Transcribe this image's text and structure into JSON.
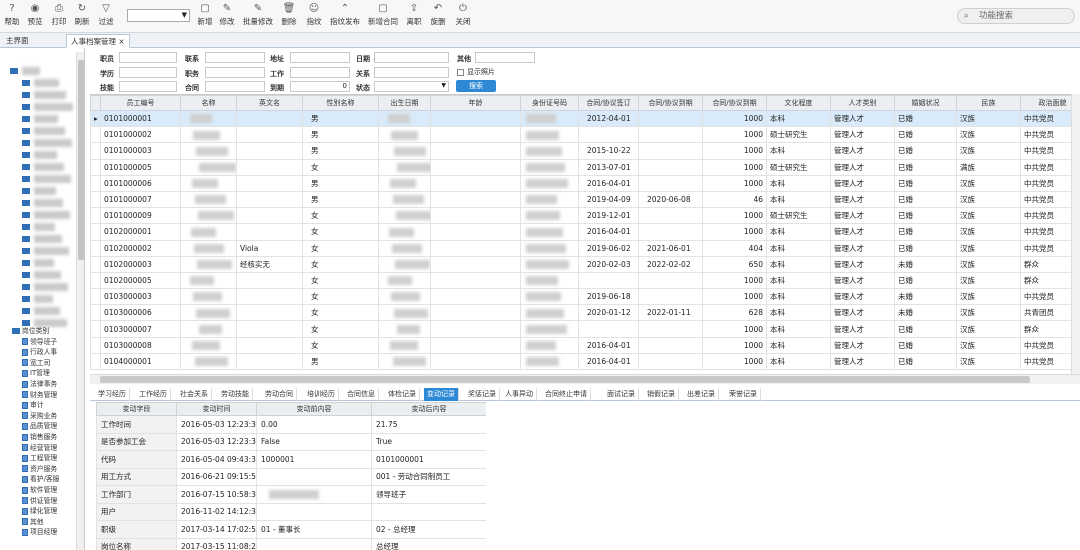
{
  "toolbar": {
    "buttons": [
      {
        "label": "帮助",
        "icon": "help-icon",
        "glyph": "?"
      },
      {
        "label": "预览",
        "icon": "eye-icon",
        "glyph": "◉"
      },
      {
        "label": "打印",
        "icon": "printer-icon",
        "glyph": "⎙"
      },
      {
        "label": "刷新",
        "icon": "refresh-icon",
        "glyph": "↻"
      },
      {
        "label": "过滤",
        "icon": "filter-icon",
        "glyph": "▽"
      },
      {
        "label": "新增",
        "icon": "new-icon",
        "glyph": "▢"
      },
      {
        "label": "修改",
        "icon": "edit-icon",
        "glyph": "✎"
      },
      {
        "label": "批量修改",
        "icon": "batch-edit-icon",
        "glyph": "✎"
      },
      {
        "label": "删除",
        "icon": "delete-icon",
        "glyph": "🗑"
      },
      {
        "label": "指纹",
        "icon": "user-icon",
        "glyph": "☺"
      },
      {
        "label": "指纹发布",
        "icon": "publish-icon",
        "glyph": "⌃"
      },
      {
        "label": "新增合同",
        "icon": "new-contract-icon",
        "glyph": "▢"
      },
      {
        "label": "离职",
        "icon": "export-icon",
        "glyph": "⇪"
      },
      {
        "label": "旋删",
        "icon": "undo-icon",
        "glyph": "↶"
      },
      {
        "label": "关闭",
        "icon": "power-icon",
        "glyph": "⏻"
      }
    ],
    "search_placeholder": "功能搜索"
  },
  "tabs": [
    {
      "label": "主界面"
    },
    {
      "label": "人事档案管理"
    }
  ],
  "tree": {
    "bottom_items": [
      "岗位类别",
      "领导班子",
      "行政人事",
      "宽工司",
      "IT管理",
      "法律事务",
      "财务管理",
      "审计",
      "采购业务",
      "品质管理",
      "销售服务",
      "经营管理",
      "工程管理",
      "资户服务",
      "看护/客服",
      "软件管理",
      "供证管理",
      "绿化管理",
      "其他",
      "项目经理"
    ]
  },
  "filters": {
    "labels": [
      "职员",
      "联系",
      "地址",
      "日期",
      "其他",
      "学历",
      "职务",
      "工作",
      "关系",
      "技能",
      "合同",
      "到期",
      "状态"
    ],
    "show_photo": "显示照片",
    "date_value": "0",
    "search_button": "搜索"
  },
  "grid": {
    "columns": [
      "员工编号",
      "名称",
      "英文名",
      "性别名称",
      "出生日期",
      "年龄",
      "身份证号码",
      "合同/协议签订",
      "合同/协议到期",
      "合同/协议到期",
      "文化程度",
      "人才类别",
      "婚姻状况",
      "民族",
      "政治面貌"
    ],
    "rows": [
      {
        "id": "0101000001",
        "en": "",
        "sex": "男",
        "sign": "2012-04-01",
        "end": "",
        "days": "1000",
        "edu": "本科",
        "talent": "管理人才",
        "marital": "已婚",
        "ethnic": "汉族",
        "political": "中共党员"
      },
      {
        "id": "0101000002",
        "en": "",
        "sex": "男",
        "sign": "",
        "end": "",
        "days": "1000",
        "edu": "硕士研究生",
        "talent": "管理人才",
        "marital": "已婚",
        "ethnic": "汉族",
        "political": "中共党员"
      },
      {
        "id": "0101000003",
        "en": "",
        "sex": "男",
        "sign": "2015-10-22",
        "end": "",
        "days": "1000",
        "edu": "本科",
        "talent": "管理人才",
        "marital": "已婚",
        "ethnic": "汉族",
        "political": "中共党员"
      },
      {
        "id": "0101000005",
        "en": "",
        "sex": "女",
        "sign": "2013-07-01",
        "end": "",
        "days": "1000",
        "edu": "硕士研究生",
        "talent": "管理人才",
        "marital": "已婚",
        "ethnic": "满族",
        "political": "中共党员"
      },
      {
        "id": "0101000006",
        "en": "",
        "sex": "男",
        "sign": "2016-04-01",
        "end": "",
        "days": "1000",
        "edu": "本科",
        "talent": "管理人才",
        "marital": "已婚",
        "ethnic": "汉族",
        "political": "中共党员"
      },
      {
        "id": "0101000007",
        "en": "",
        "sex": "男",
        "sign": "2019-04-09",
        "end": "2020-06-08",
        "days": "46",
        "edu": "本科",
        "talent": "管理人才",
        "marital": "已婚",
        "ethnic": "汉族",
        "political": "中共党员"
      },
      {
        "id": "0101000009",
        "en": "",
        "sex": "女",
        "sign": "2019-12-01",
        "end": "",
        "days": "1000",
        "edu": "硕士研究生",
        "talent": "管理人才",
        "marital": "已婚",
        "ethnic": "汉族",
        "political": "中共党员"
      },
      {
        "id": "0102000001",
        "en": "",
        "sex": "女",
        "sign": "2016-04-01",
        "end": "",
        "days": "1000",
        "edu": "本科",
        "talent": "管理人才",
        "marital": "已婚",
        "ethnic": "汉族",
        "political": "中共党员"
      },
      {
        "id": "0102000002",
        "en": "Viola",
        "sex": "女",
        "sign": "2019-06-02",
        "end": "2021-06-01",
        "days": "404",
        "edu": "本科",
        "talent": "管理人才",
        "marital": "已婚",
        "ethnic": "汉族",
        "political": "中共党员"
      },
      {
        "id": "0102000003",
        "en": "经核实无",
        "sex": "女",
        "sign": "2020-02-03",
        "end": "2022-02-02",
        "days": "650",
        "edu": "本科",
        "talent": "管理人才",
        "marital": "未婚",
        "ethnic": "汉族",
        "political": "群众"
      },
      {
        "id": "0102000005",
        "en": "",
        "sex": "女",
        "sign": "",
        "end": "",
        "days": "1000",
        "edu": "本科",
        "talent": "管理人才",
        "marital": "已婚",
        "ethnic": "汉族",
        "political": "群众"
      },
      {
        "id": "0103000003",
        "en": "",
        "sex": "女",
        "sign": "2019-06-18",
        "end": "",
        "days": "1000",
        "edu": "本科",
        "talent": "管理人才",
        "marital": "未婚",
        "ethnic": "汉族",
        "political": "中共党员"
      },
      {
        "id": "0103000006",
        "en": "",
        "sex": "女",
        "sign": "2020-01-12",
        "end": "2022-01-11",
        "days": "628",
        "edu": "本科",
        "talent": "管理人才",
        "marital": "未婚",
        "ethnic": "汉族",
        "political": "共青团员"
      },
      {
        "id": "0103000007",
        "en": "",
        "sex": "女",
        "sign": "",
        "end": "",
        "days": "1000",
        "edu": "本科",
        "talent": "管理人才",
        "marital": "已婚",
        "ethnic": "汉族",
        "political": "群众"
      },
      {
        "id": "0103000008",
        "en": "",
        "sex": "女",
        "sign": "2016-04-01",
        "end": "",
        "days": "1000",
        "edu": "本科",
        "talent": "管理人才",
        "marital": "已婚",
        "ethnic": "汉族",
        "political": "中共党员"
      },
      {
        "id": "0104000001",
        "en": "",
        "sex": "男",
        "sign": "2016-04-01",
        "end": "",
        "days": "1000",
        "edu": "本科",
        "talent": "管理人才",
        "marital": "已婚",
        "ethnic": "汉族",
        "political": "中共党员"
      }
    ]
  },
  "subtabs": [
    "学习经历",
    "工作经历",
    "社会关系",
    "劳动技能",
    "劳动合同",
    "培训经历",
    "合同信息",
    "体检记录",
    "变动记录",
    "奖惩记录",
    "人事异动",
    "合同终止申请",
    "面试记录",
    "销假记录",
    "出差记录",
    "荣誉记录"
  ],
  "detail": {
    "columns": [
      "变动字段",
      "变动时间",
      "变动前内容",
      "变动后内容"
    ],
    "rows": [
      {
        "field": "工作时间",
        "time": "2016-05-03 12:23:3",
        "before": "0.00",
        "after": "21.75"
      },
      {
        "field": "是否参加工会",
        "time": "2016-05-03 12:23:3",
        "before": "False",
        "after": "True"
      },
      {
        "field": "代码",
        "time": "2016-05-04 09:43:3",
        "before": "1000001",
        "after": "0101000001"
      },
      {
        "field": "用工方式",
        "time": "2016-06-21 09:15:5",
        "before": "",
        "after": "001 - 劳动合同制员工"
      },
      {
        "field": "工作部门",
        "time": "2016-07-15 10:58:3",
        "before": "",
        "after": "领导班子"
      },
      {
        "field": "用户",
        "time": "2016-11-02 14:12:3",
        "before": "",
        "after": ""
      },
      {
        "field": "职级",
        "time": "2017-03-14 17:02:5",
        "before": "01 - 董事长",
        "after": "02 - 总经理"
      },
      {
        "field": "岗位名称",
        "time": "2017-03-15 11:08:2",
        "before": "",
        "after": "总经理"
      }
    ]
  },
  "colors": {
    "accent": "#2d89d6",
    "folder": "#2f6fb5",
    "selected_row": "#d9ebfa"
  }
}
